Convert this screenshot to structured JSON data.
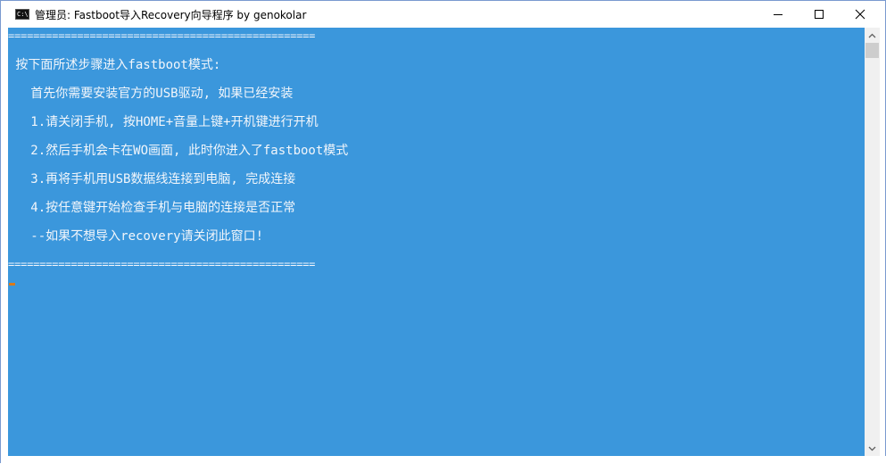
{
  "window": {
    "title": "管理员:  Fastboot导入Recovery向导程序 by genokolar",
    "icon": "cmd-console-icon",
    "controls": {
      "minimize": "minimize-icon",
      "maximize": "maximize-icon",
      "close": "close-icon"
    }
  },
  "console": {
    "background": "#3b97dc",
    "text_color": "#f2f6fb",
    "lines": [
      "=================================================",
      " 按下面所述步骤进入fastboot模式:",
      "   首先你需要安装官方的USB驱动, 如果已经安装",
      "   1.请关闭手机, 按HOME+音量上键+开机键进行开机",
      "   2.然后手机会卡在WO画面, 此时你进入了fastboot模式",
      "   3.再将手机用USB数据线连接到电脑, 完成连接",
      "   4.按任意键开始检查手机与电脑的连接是否正常",
      "   --如果不想导入recovery请关闭此窗口!",
      "================================================="
    ]
  },
  "scrollbar": {
    "up_icon": "scroll-up-icon",
    "down_icon": "scroll-down-icon"
  }
}
